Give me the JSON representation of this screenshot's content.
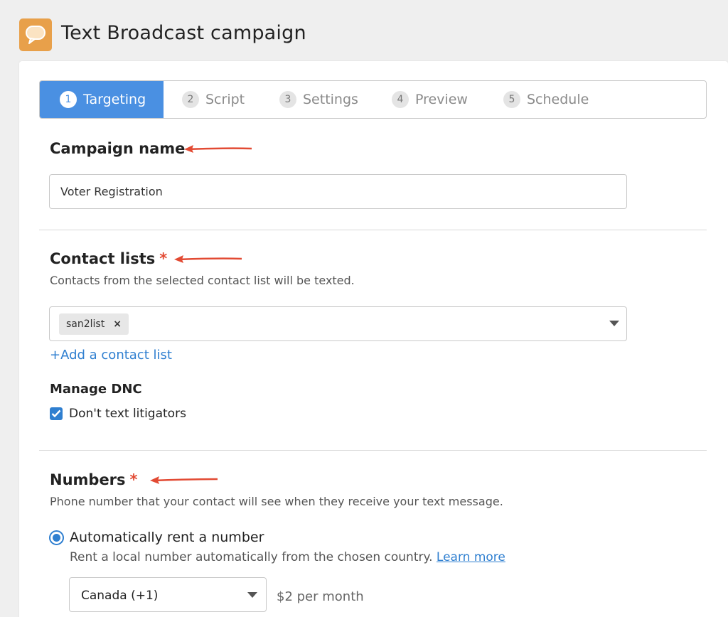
{
  "header": {
    "title": "Text Broadcast campaign",
    "icon": "chat-bubble-icon",
    "icon_color": "#e8a04a"
  },
  "steps": [
    {
      "num": "1",
      "label": "Targeting",
      "active": true
    },
    {
      "num": "2",
      "label": "Script",
      "active": false
    },
    {
      "num": "3",
      "label": "Settings",
      "active": false
    },
    {
      "num": "4",
      "label": "Preview",
      "active": false
    },
    {
      "num": "5",
      "label": "Schedule",
      "active": false
    }
  ],
  "campaign_name": {
    "title": "Campaign name",
    "value": "Voter Registration"
  },
  "contact_lists": {
    "title": "Contact lists",
    "required": "*",
    "description": "Contacts from the selected contact list will be texted.",
    "selected": [
      {
        "label": "san2list",
        "remove": "×"
      }
    ],
    "add_link": "+Add a contact list"
  },
  "dnc": {
    "title": "Manage DNC",
    "checkbox_label": "Don't text litigators",
    "checked": true
  },
  "numbers": {
    "title": "Numbers",
    "required": "*",
    "description": "Phone number that your contact will see when they receive your text message.",
    "option_label": "Automatically rent a number",
    "option_desc": "Rent a local number automatically from the chosen country.",
    "learn_more": "Learn more",
    "country": "Canada (+1)",
    "price": "$2 per month"
  },
  "colors": {
    "accent": "#4a90e2",
    "link": "#2f7fd0",
    "required": "#e24a33",
    "annotation_arrow": "#e24a33"
  }
}
